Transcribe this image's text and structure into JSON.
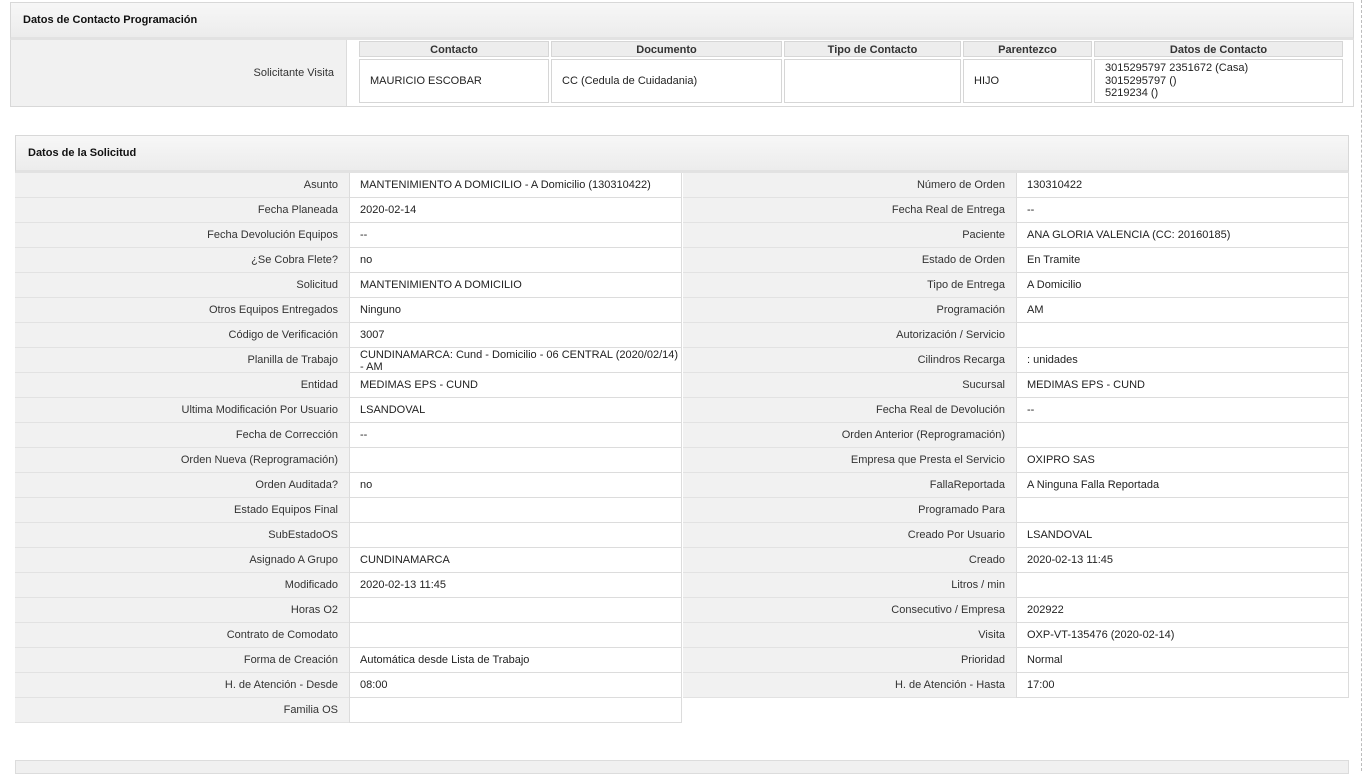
{
  "contact_section": {
    "title": "Datos de Contacto Programación",
    "row_label": "Solicitante Visita",
    "headers": [
      "Contacto",
      "Documento",
      "Tipo de Contacto",
      "Parentezco",
      "Datos de Contacto"
    ],
    "row": {
      "contacto": "MAURICIO ESCOBAR",
      "documento": "CC (Cedula de Cuidadania)",
      "tipo": "",
      "parentezco": "HIJO",
      "datos": [
        "3015295797 2351672 (Casa)",
        "3015295797 ()",
        "5219234 ()"
      ]
    }
  },
  "request_section": {
    "title": "Datos de la Solicitud",
    "left": [
      {
        "label": "Asunto",
        "value": "MANTENIMIENTO A DOMICILIO - A Domicilio (130310422)"
      },
      {
        "label": "Fecha Planeada",
        "value": "2020-02-14"
      },
      {
        "label": "Fecha Devolución Equipos",
        "value": "--"
      },
      {
        "label": "¿Se Cobra Flete?",
        "value": "no"
      },
      {
        "label": "Solicitud",
        "value": "MANTENIMIENTO A DOMICILIO"
      },
      {
        "label": "Otros Equipos Entregados",
        "value": "Ninguno"
      },
      {
        "label": "Código de Verificación",
        "value": "3007"
      },
      {
        "label": "Planilla de Trabajo",
        "value": "CUNDINAMARCA: Cund - Domicilio - 06 CENTRAL (2020/02/14) - AM"
      },
      {
        "label": "Entidad",
        "value": "MEDIMAS EPS - CUND"
      },
      {
        "label": "Ultima Modificación Por Usuario",
        "value": "LSANDOVAL"
      },
      {
        "label": "Fecha de Corrección",
        "value": "--"
      },
      {
        "label": "Orden Nueva (Reprogramación)",
        "value": ""
      },
      {
        "label": "Orden Auditada?",
        "value": "no"
      },
      {
        "label": "Estado Equipos Final",
        "value": ""
      },
      {
        "label": "SubEstadoOS",
        "value": ""
      },
      {
        "label": "Asignado A Grupo",
        "value": "CUNDINAMARCA"
      },
      {
        "label": "Modificado",
        "value": "2020-02-13 11:45"
      },
      {
        "label": "Horas O2",
        "value": ""
      },
      {
        "label": "Contrato de Comodato",
        "value": ""
      },
      {
        "label": "Forma de Creación",
        "value": "Automática desde Lista de Trabajo"
      },
      {
        "label": "H. de Atención - Desde",
        "value": "08:00"
      },
      {
        "label": "Familia OS",
        "value": ""
      }
    ],
    "right": [
      {
        "label": "Número de Orden",
        "value": "130310422"
      },
      {
        "label": "Fecha Real de Entrega",
        "value": "--"
      },
      {
        "label": "Paciente",
        "value": "ANA GLORIA VALENCIA (CC: 20160185)"
      },
      {
        "label": "Estado de Orden",
        "value": "En Tramite"
      },
      {
        "label": "Tipo de Entrega",
        "value": "A Domicilio"
      },
      {
        "label": "Programación",
        "value": "AM"
      },
      {
        "label": "Autorización / Servicio",
        "value": ""
      },
      {
        "label": "Cilindros Recarga",
        "value": ": unidades"
      },
      {
        "label": "Sucursal",
        "value": "MEDIMAS EPS - CUND"
      },
      {
        "label": "Fecha Real de Devolución",
        "value": "--"
      },
      {
        "label": "Orden Anterior (Reprogramación)",
        "value": ""
      },
      {
        "label": "Empresa que Presta el Servicio",
        "value": "OXIPRO SAS"
      },
      {
        "label": "FallaReportada",
        "value": "A Ninguna Falla Reportada"
      },
      {
        "label": "Programado Para",
        "value": ""
      },
      {
        "label": "Creado Por Usuario",
        "value": "LSANDOVAL"
      },
      {
        "label": "Creado",
        "value": "2020-02-13 11:45"
      },
      {
        "label": "Litros / min",
        "value": ""
      },
      {
        "label": "Consecutivo / Empresa",
        "value": "202922"
      },
      {
        "label": "Visita",
        "value": "OXP-VT-135476 (2020-02-14)"
      },
      {
        "label": "Prioridad",
        "value": "Normal"
      },
      {
        "label": "H. de Atención - Hasta",
        "value": "17:00"
      }
    ]
  }
}
